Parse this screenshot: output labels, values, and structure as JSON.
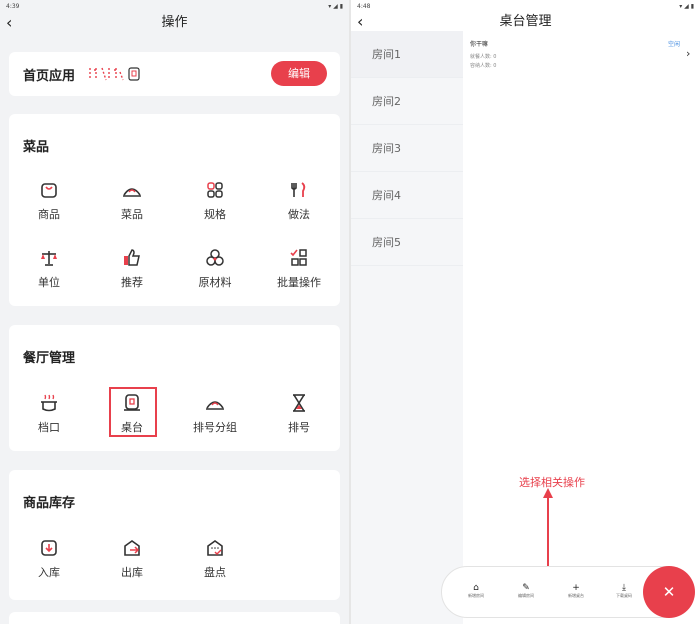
{
  "left": {
    "status": {
      "time": "4:39"
    },
    "nav": {
      "title": "操作",
      "back_icon": "chevron-left-icon"
    },
    "home_apps": {
      "title": "首页应用",
      "edit_label": "编辑"
    },
    "dishes": {
      "title": "菜品",
      "items": [
        {
          "label": "商品",
          "icon": "bag-icon"
        },
        {
          "label": "菜品",
          "icon": "cloche-icon"
        },
        {
          "label": "规格",
          "icon": "grid-icon"
        },
        {
          "label": "做法",
          "icon": "cutlery-icon"
        },
        {
          "label": "单位",
          "icon": "scale-icon"
        },
        {
          "label": "推荐",
          "icon": "thumbs-up-icon"
        },
        {
          "label": "原材料",
          "icon": "circles-icon"
        },
        {
          "label": "批量操作",
          "icon": "batch-icon"
        }
      ]
    },
    "restaurant": {
      "title": "餐厅管理",
      "items": [
        {
          "label": "档口",
          "icon": "stall-icon"
        },
        {
          "label": "桌台",
          "icon": "table-icon"
        },
        {
          "label": "排号分组",
          "icon": "cloche-icon"
        },
        {
          "label": "排号",
          "icon": "hourglass-icon"
        }
      ]
    },
    "stock": {
      "title": "商品库存",
      "items": [
        {
          "label": "入库",
          "icon": "inbox-icon"
        },
        {
          "label": "出库",
          "icon": "outbox-icon"
        },
        {
          "label": "盘点",
          "icon": "inventory-icon"
        }
      ]
    }
  },
  "right": {
    "status": {
      "time": "4:48"
    },
    "nav": {
      "title": "桌台管理"
    },
    "rooms": [
      "房间1",
      "房间2",
      "房间3",
      "房间4",
      "房间5"
    ],
    "table": {
      "name": "你干嘛",
      "status": "空闲",
      "seated": "就餐人数: 0",
      "capacity": "容纳人数: 0"
    },
    "bottom_bar": [
      {
        "label": "新增房间",
        "icon": "home-icon"
      },
      {
        "label": "编辑房间",
        "icon": "pencil-icon"
      },
      {
        "label": "新增桌台",
        "icon": "plus-icon"
      },
      {
        "label": "下载桌码",
        "icon": "download-icon"
      }
    ],
    "annotation": "选择相关操作",
    "colors": {
      "accent": "#e8404c"
    }
  }
}
